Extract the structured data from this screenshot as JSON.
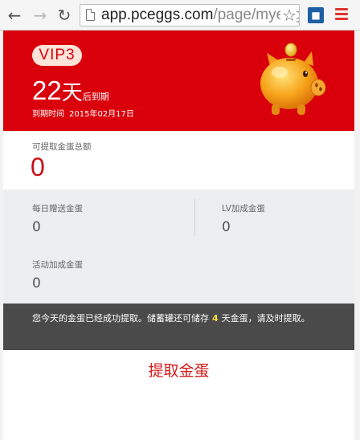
{
  "browser": {
    "url_host": "app.pceggs.com",
    "url_path": "/page/myegg"
  },
  "header": {
    "vip_level": "VIP3",
    "days_number": "22",
    "days_unit": "天",
    "days_suffix": "后到期",
    "expire_label": "到期时间",
    "expire_date": "2015年02月17日"
  },
  "total": {
    "label": "可提取金蛋总额",
    "value": "0"
  },
  "stats": {
    "daily_label": "每日赠送金蛋",
    "daily_value": "0",
    "lv_label": "LV加成金蛋",
    "lv_value": "0",
    "activity_label": "活动加成金蛋",
    "activity_value": "0"
  },
  "notice": {
    "text_before": "您今天的金蛋已经成功提取。储蓄罐还可储存",
    "days": "4",
    "text_after": "天金蛋，请及时提取。"
  },
  "action": {
    "withdraw_label": "提取金蛋"
  },
  "colors": {
    "header_red": "#d9000b",
    "accent_red": "#c81018",
    "notice_bg": "#4a4a4a",
    "highlight_yellow": "#ffdc3c"
  },
  "icons": [
    "back-icon",
    "forward-icon",
    "reload-icon",
    "page-icon",
    "star-icon",
    "extension-icon",
    "menu-icon",
    "piggy-bank-icon"
  ]
}
